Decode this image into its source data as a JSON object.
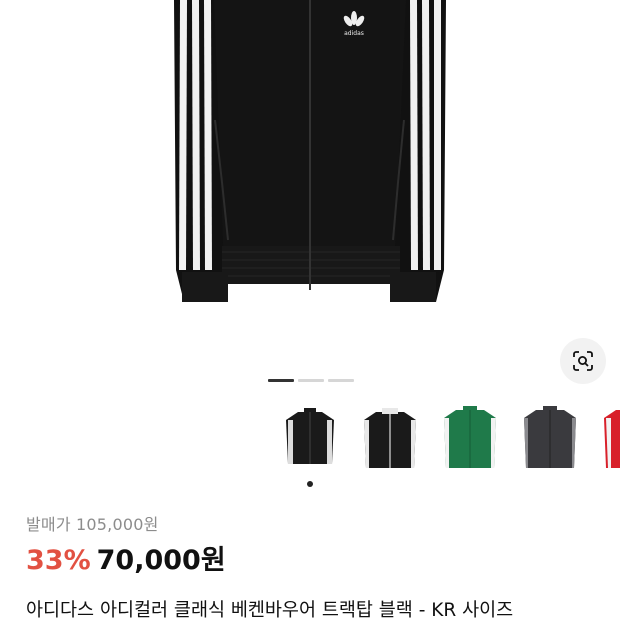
{
  "product": {
    "logo_text": "adidas",
    "original_price": "발매가 105,000원",
    "discount": "33%",
    "price": "70,000원",
    "title": "아디다스 아디컬러 클래식 베켄바우어 트랙탑 블랙 - KR 사이즈"
  },
  "gallery": {
    "image_count": 3,
    "active_index": 0
  },
  "color_options": [
    {
      "name": "black-white-stripes",
      "color": "#1a1a1a"
    },
    {
      "name": "black-white-collar",
      "color": "#1a1a1a"
    },
    {
      "name": "green",
      "color": "#1f7a4a"
    },
    {
      "name": "dark-grey",
      "color": "#3a3a3e"
    },
    {
      "name": "red",
      "color": "#d8202a"
    }
  ],
  "selected_option": 0,
  "colors": {
    "accent_discount": "#e25142",
    "muted_text": "#8c8c8c"
  }
}
